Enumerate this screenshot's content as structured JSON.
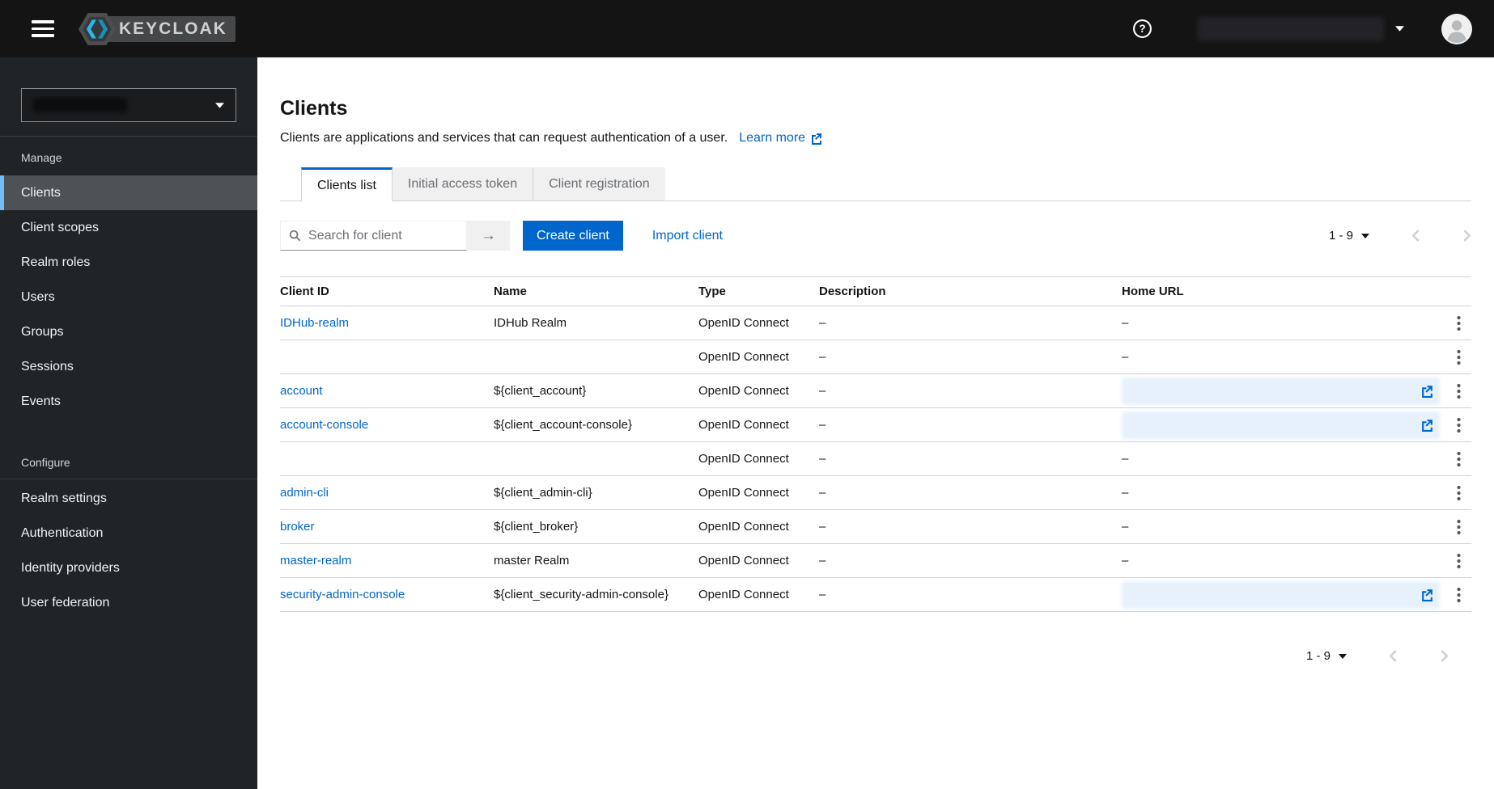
{
  "masthead": {
    "brand": "KEYCLOAK"
  },
  "sidebar": {
    "realm_selector_redacted": true,
    "groups": [
      {
        "title": "Manage",
        "active_item": "Clients",
        "items": [
          "Clients",
          "Client scopes",
          "Realm roles",
          "Users",
          "Groups",
          "Sessions",
          "Events"
        ]
      },
      {
        "title": "Configure",
        "items": [
          "Realm settings",
          "Authentication",
          "Identity providers",
          "User federation"
        ]
      }
    ]
  },
  "page": {
    "title": "Clients",
    "description": "Clients are applications and services that can request authentication of a user.",
    "learn_more_label": "Learn more",
    "tabs": [
      {
        "label": "Clients list",
        "active": true
      },
      {
        "label": "Initial access token",
        "active": false
      },
      {
        "label": "Client registration",
        "active": false
      }
    ],
    "toolbar": {
      "search_placeholder": "Search for client",
      "create_button": "Create client",
      "import_link": "Import client"
    },
    "pagination": {
      "label": "1 - 9"
    },
    "table": {
      "columns": [
        "Client ID",
        "Name",
        "Type",
        "Description",
        "Home URL"
      ],
      "rows": [
        {
          "client_id": "IDHub-realm",
          "name": "IDHub Realm",
          "type": "OpenID Connect",
          "description": "–",
          "home_url": "–"
        },
        {
          "client_id_redacted": true,
          "name_redacted": true,
          "type": "OpenID Connect",
          "description": "–",
          "home_url": "–"
        },
        {
          "client_id": "account",
          "name": "${client_account}",
          "type": "OpenID Connect",
          "description": "–",
          "home_url_redacted": true,
          "home_url_external": true
        },
        {
          "client_id": "account-console",
          "name": "${client_account-console}",
          "type": "OpenID Connect",
          "description": "–",
          "home_url_redacted": true,
          "home_url_external": true
        },
        {
          "client_id_redacted": true,
          "name_redacted": true,
          "type": "OpenID Connect",
          "description": "–",
          "home_url": "–"
        },
        {
          "client_id": "admin-cli",
          "name": "${client_admin-cli}",
          "type": "OpenID Connect",
          "description": "–",
          "home_url": "–"
        },
        {
          "client_id": "broker",
          "name": "${client_broker}",
          "type": "OpenID Connect",
          "description": "–",
          "home_url": "–"
        },
        {
          "client_id": "master-realm",
          "name": "master Realm",
          "type": "OpenID Connect",
          "description": "–",
          "home_url": "–"
        },
        {
          "client_id": "security-admin-console",
          "name": "${client_security-admin-console}",
          "type": "OpenID Connect",
          "description": "–",
          "home_url_redacted": true,
          "home_url_external": true
        }
      ]
    }
  },
  "colors": {
    "primary": "#0066cc",
    "masthead_bg": "#141414",
    "sidebar_bg": "#212427",
    "active_nav_bg": "#4f5255",
    "active_nav_accent": "#73bcf7",
    "border": "#d2d2d2",
    "text": "#151515",
    "muted": "#6a6e73"
  }
}
